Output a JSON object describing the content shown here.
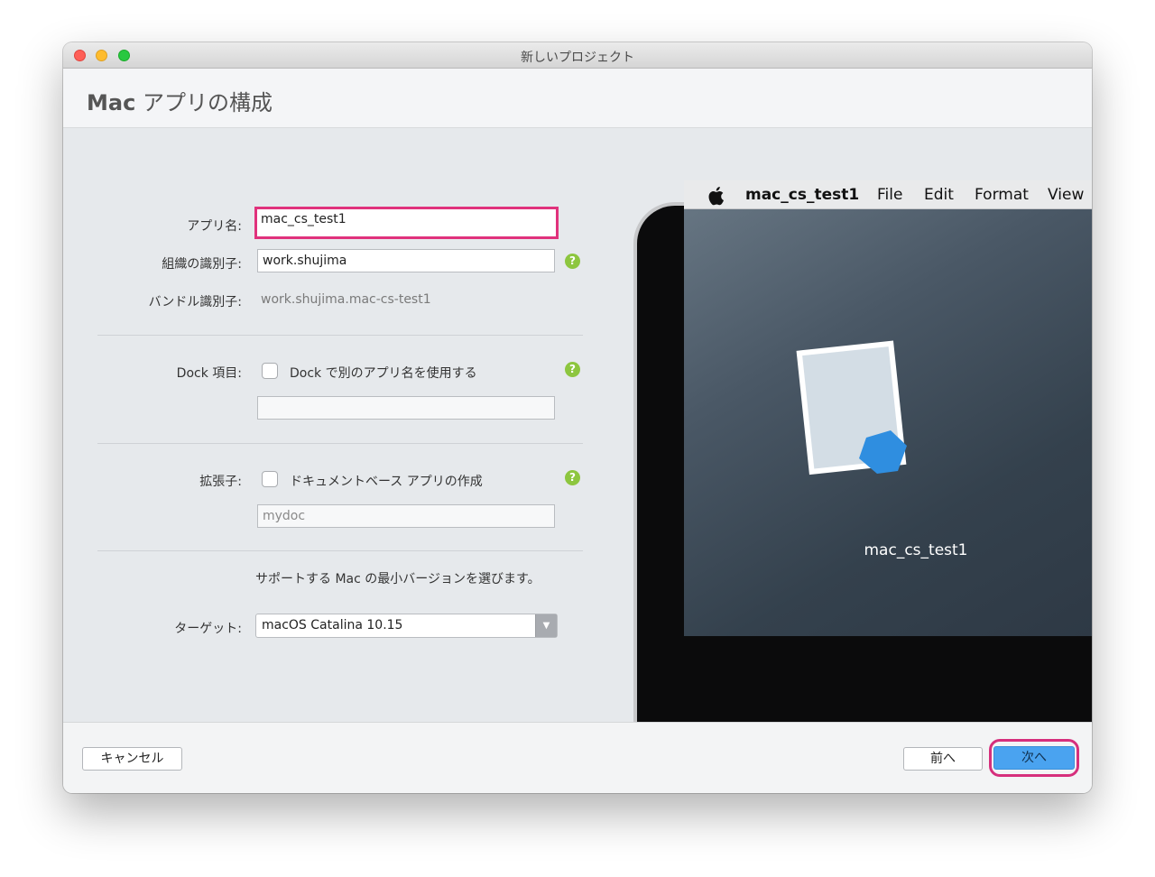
{
  "window": {
    "title": "新しいプロジェクト"
  },
  "header": {
    "title_bold": "Mac",
    "title_rest": " アプリの構成"
  },
  "form": {
    "app_name_label": "アプリ名:",
    "app_name_value": "mac_cs_test1",
    "org_label": "組織の識別子:",
    "org_value": "work.shujima",
    "bundle_label": "バンドル識別子:",
    "bundle_value": "work.shujima.mac-cs-test1",
    "dock_label": "Dock 項目:",
    "dock_checkbox_label": "Dock で別のアプリ名を使用する",
    "dock_field_value": "",
    "ext_label": "拡張子:",
    "ext_checkbox_label": "ドキュメントベース アプリの作成",
    "ext_field_placeholder": "mydoc",
    "target_desc": "サポートする Mac の最小バージョンを選びます。",
    "target_label": "ターゲット:",
    "target_value": "macOS Catalina 10.15",
    "help_glyph": "?"
  },
  "preview": {
    "menu_app": "mac_cs_test1",
    "menu_file": "File",
    "menu_edit": "Edit",
    "menu_format": "Format",
    "menu_view": "View",
    "icon_label": "mac_cs_test1"
  },
  "footer": {
    "cancel": "キャンセル",
    "back": "前へ",
    "next": "次へ"
  },
  "colors": {
    "highlight": "#e0327c",
    "primary_button": "#4aa3f0",
    "help_icon": "#8dc63f"
  }
}
